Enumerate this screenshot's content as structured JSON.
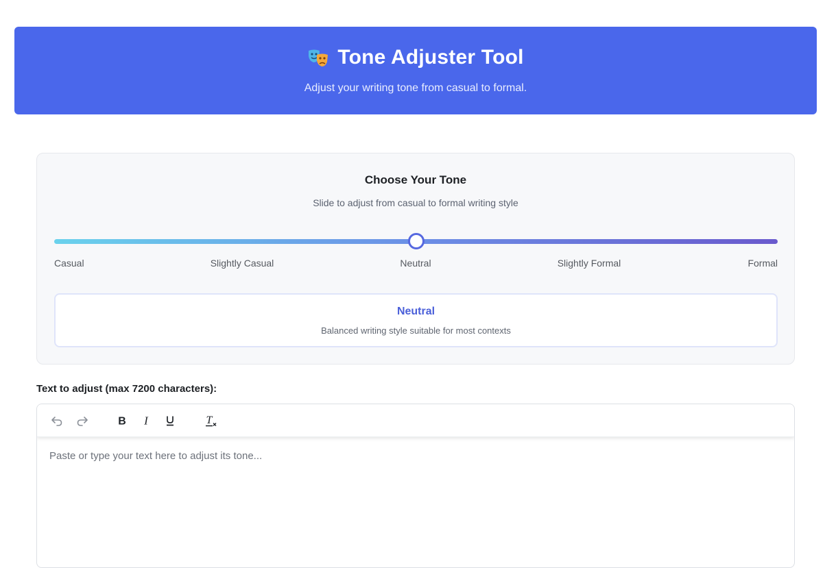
{
  "header": {
    "title": "Tone Adjuster Tool",
    "subtitle": "Adjust your writing tone from casual to formal.",
    "icon": "theater-masks-icon",
    "background": "#4a67eb"
  },
  "tone_panel": {
    "title": "Choose Your Tone",
    "subtitle": "Slide to adjust from casual to formal writing style",
    "slider": {
      "labels": [
        "Casual",
        "Slightly Casual",
        "Neutral",
        "Slightly Formal",
        "Formal"
      ],
      "selected_index": 2,
      "value_fraction": 0.5
    },
    "selected": {
      "name": "Neutral",
      "description": "Balanced writing style suitable for most contexts"
    }
  },
  "editor": {
    "label": "Text to adjust (max 7200 characters):",
    "placeholder": "Paste or type your text here to adjust its tone...",
    "toolbar": [
      "undo-icon",
      "redo-icon",
      "bold-icon",
      "italic-icon",
      "underline-icon",
      "clear-format-icon"
    ]
  },
  "colors": {
    "accent": "#4a5fd9",
    "slider_start": "#6ad2ec",
    "slider_end": "#6a5acd"
  }
}
